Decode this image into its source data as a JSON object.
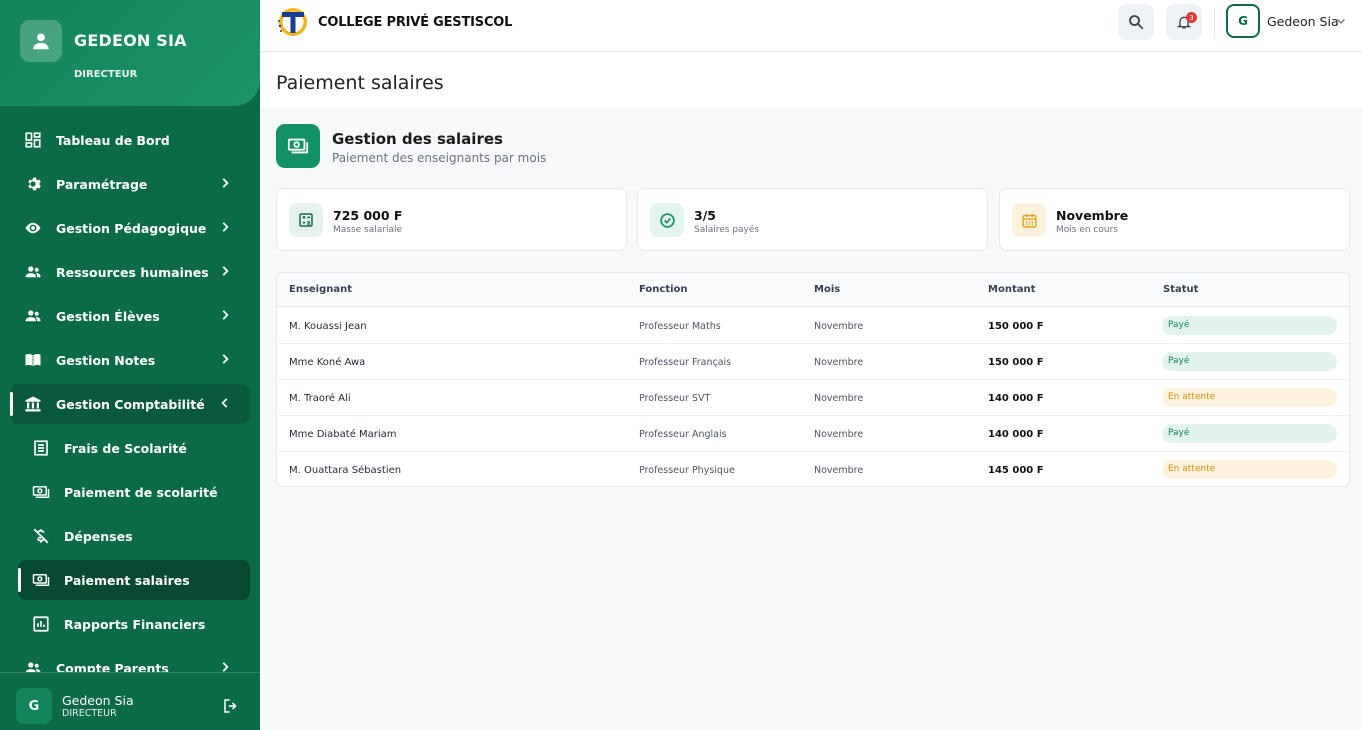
{
  "sidebar": {
    "user_name": "GEDEON SIA",
    "user_role": "DIRECTEUR",
    "items": [
      {
        "label": "Tableau de Bord",
        "icon": "dashboard-icon"
      },
      {
        "label": "Paramétrage",
        "icon": "gear-icon"
      },
      {
        "label": "Gestion Pédagogique",
        "icon": "eye-icon"
      },
      {
        "label": "Ressources humaines",
        "icon": "people-icon"
      },
      {
        "label": "Gestion Élèves",
        "icon": "people-icon"
      },
      {
        "label": "Gestion Notes",
        "icon": "book-icon"
      },
      {
        "label": "Gestion Comptabilité",
        "icon": "bank-icon"
      }
    ],
    "sub_items": [
      {
        "label": "Frais de Scolarité",
        "icon": "receipt-icon"
      },
      {
        "label": "Paiement de scolarité",
        "icon": "cash-icon"
      },
      {
        "label": "Dépenses",
        "icon": "money-off-icon"
      },
      {
        "label": "Paiement salaires",
        "icon": "cash-icon"
      },
      {
        "label": "Rapports Financiers",
        "icon": "report-icon"
      }
    ],
    "extra_item": {
      "label": "Compte Parents",
      "icon": "people-icon"
    },
    "footer": {
      "avatar_letter": "G",
      "name": "Gedeon Sia",
      "role": "DIRECTEUR"
    }
  },
  "topbar": {
    "app_title": "COLLEGE PRIVÉ GESTISCOL",
    "notification_count": "3",
    "user_letter": "G",
    "user_name": "Gedeon Sia"
  },
  "page": {
    "title": "Paiement salaires",
    "section_title": "Gestion des salaires",
    "section_subtitle": "Paiement des enseignants par mois"
  },
  "stats": [
    {
      "value": "725 000 F",
      "label": "Masse salariale",
      "icon": "calculator-icon",
      "color": "#0b6b47"
    },
    {
      "value": "3/5",
      "label": "Salaires payés",
      "icon": "check-circle-icon",
      "color": "#139166"
    },
    {
      "value": "Novembre",
      "label": "Mois en cours",
      "icon": "calendar-icon",
      "color": "#e0a21a"
    }
  ],
  "table": {
    "headers": [
      "Enseignant",
      "Fonction",
      "Mois",
      "Montant",
      "Statut"
    ],
    "rows": [
      {
        "name": "M. Kouassi Jean",
        "role": "Professeur Maths",
        "month": "Novembre",
        "amount": "150 000 F",
        "status": "Payé",
        "state": "paid"
      },
      {
        "name": "Mme Koné Awa",
        "role": "Professeur Français",
        "month": "Novembre",
        "amount": "150 000 F",
        "status": "Payé",
        "state": "paid"
      },
      {
        "name": "M. Traoré Ali",
        "role": "Professeur SVT",
        "month": "Novembre",
        "amount": "140 000 F",
        "status": "En attente",
        "state": "wait"
      },
      {
        "name": "Mme Diabaté Mariam",
        "role": "Professeur Anglais",
        "month": "Novembre",
        "amount": "140 000 F",
        "status": "Payé",
        "state": "paid"
      },
      {
        "name": "M. Ouattara Sébastien",
        "role": "Professeur Physique",
        "month": "Novembre",
        "amount": "145 000 F",
        "status": "En attente",
        "state": "wait"
      }
    ]
  },
  "colors": {
    "sidebar": "#0b6b47",
    "accent": "#139166",
    "paid": "#158a5c",
    "pending": "#d4900d"
  }
}
